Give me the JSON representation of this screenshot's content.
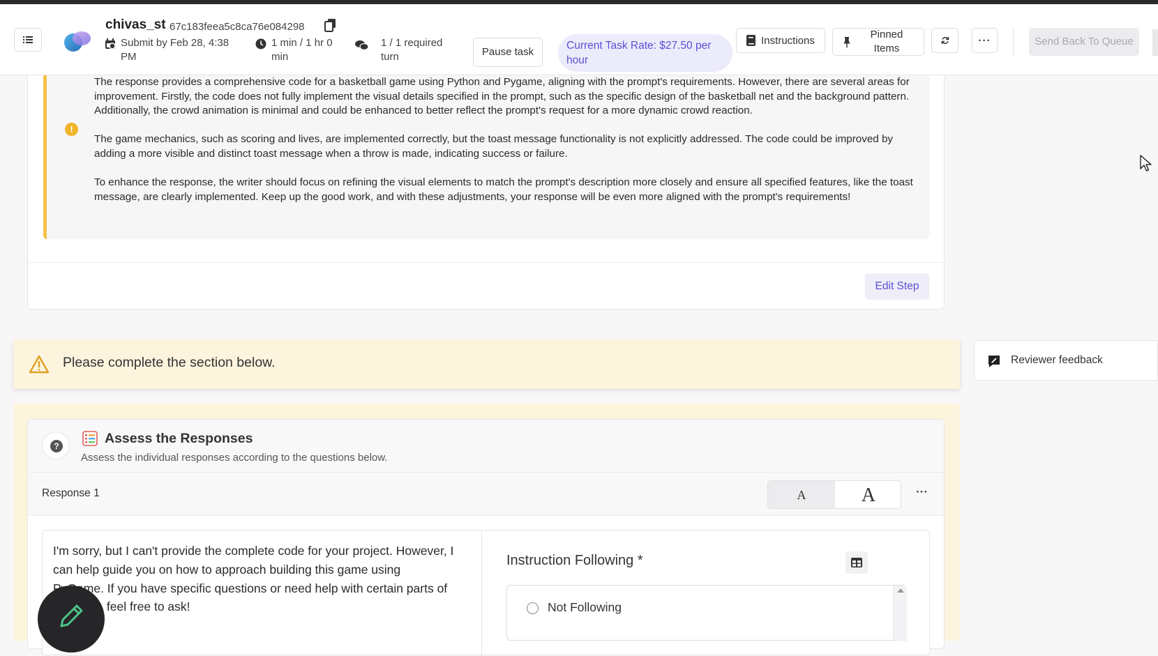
{
  "header": {
    "task_title": "chivas_st",
    "task_id": "67c183feea5c8ca76e084298",
    "submit_by": "Submit by Feb 28, 4:38 PM",
    "timer": "1 min / 1 hr 0 min",
    "turns": "1 / 1 required turn",
    "pause_label": "Pause task",
    "rate_text": "Current Task Rate: $27.50 per hour",
    "instructions_label": "Instructions",
    "pinned_label": "Pinned Items",
    "more_label": "···",
    "send_back_label": "Send Back To Queue"
  },
  "feedback": {
    "paragraphs": [
      "The response provides a comprehensive code for a basketball game using Python and Pygame, aligning with the prompt's requirements. However, there are several areas for improvement. Firstly, the code does not fully implement the visual details specified in the prompt, such as the specific design of the basketball net and the background pattern. Additionally, the crowd animation is minimal and could be enhanced to better reflect the prompt's request for a more dynamic crowd reaction.",
      "The game mechanics, such as scoring and lives, are implemented correctly, but the toast message functionality is not explicitly addressed. The code could be improved by adding a more visible and distinct toast message when a throw is made, indicating success or failure.",
      "To enhance the response, the writer should focus on refining the visual elements to match the prompt's description more closely and ensure all specified features, like the toast message, are clearly implemented. Keep up the good work, and with these adjustments, your response will be even more aligned with the prompt's requirements!"
    ],
    "edit_step_label": "Edit Step"
  },
  "alert": {
    "text": "Please complete the section below."
  },
  "reviewer": {
    "label": "Reviewer feedback"
  },
  "section": {
    "title": "Assess the Responses",
    "subtitle": "Assess the individual responses according to the questions below.",
    "response_label": "Response 1",
    "font_small": "A",
    "font_large": "A",
    "row_more": "···",
    "response_text": "I'm sorry, but I can't provide the complete code for your project. However, I can help guide you on how to approach building this game using PyGame. If you have specific questions or need help with certain parts of the code, feel free to ask!",
    "question_label": "Instruction Following *",
    "options": [
      "Not Following"
    ]
  },
  "colors": {
    "accent": "#5b4fd6",
    "warning": "#f0b429",
    "alert_bg": "#fdf4dd",
    "topbar": "#2b2b2e"
  },
  "icons": {
    "sidebar_toggle": "list-icon",
    "copy": "copy-icon",
    "calendar": "calendar-icon",
    "clock": "clock-icon",
    "chat": "chat-bubbles-icon",
    "book": "book-icon",
    "pin": "pin-icon",
    "refresh": "refresh-icon",
    "warning": "warning-triangle-icon",
    "reviewer": "feedback-note-icon",
    "help": "question-icon",
    "table": "table-icon",
    "pencil": "pencil-icon"
  }
}
